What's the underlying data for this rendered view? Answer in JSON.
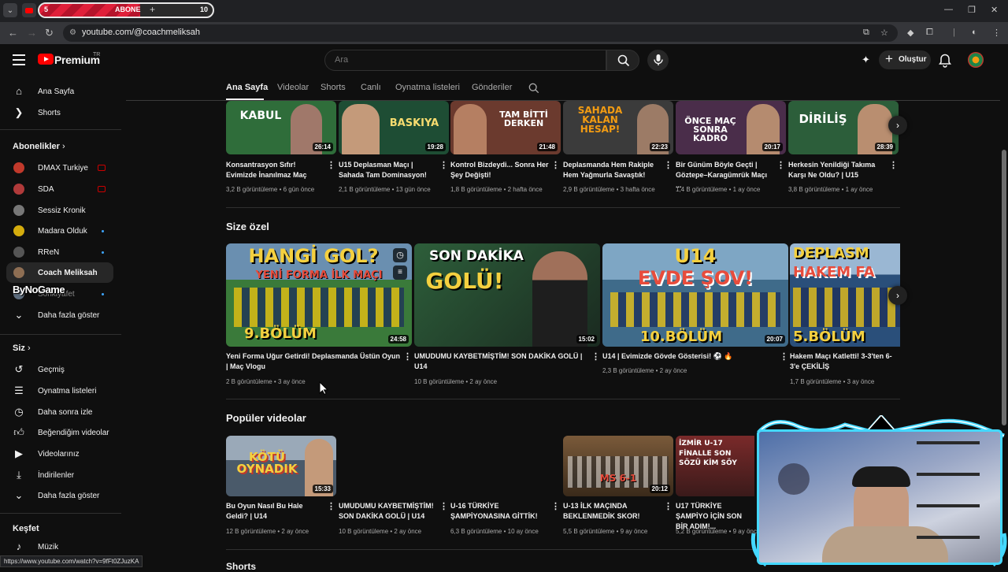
{
  "browser": {
    "subscriber_goal": {
      "start": "5",
      "label": "ABONE",
      "end": "10",
      "progress": 0.58
    },
    "url": "youtube.com/@coachmeliksah",
    "status_url": "https://www.youtube.com/watch?v=9fFt0ZJuzKA"
  },
  "header": {
    "logo_text": "Premium",
    "country_code": "TR",
    "search_placeholder": "Ara",
    "create_label": "Oluştur"
  },
  "sidebar": {
    "main": [
      {
        "label": "Ana Sayfa",
        "icon": "home-icon"
      },
      {
        "label": "Shorts",
        "icon": "shorts-icon"
      }
    ],
    "subscriptions_title": "Abonelikler",
    "subscriptions": [
      {
        "label": "DMAX Turkiye",
        "badge": "live"
      },
      {
        "label": "SDA",
        "badge": "live"
      },
      {
        "label": "Sessiz Kronik",
        "badge": ""
      },
      {
        "label": "Madara Olduk",
        "badge": "new"
      },
      {
        "label": "RReN",
        "badge": "new"
      },
      {
        "label": "Coach Meliksah",
        "badge": "",
        "active": true
      },
      {
        "label": "Sonkiyafet",
        "badge": "new"
      }
    ],
    "show_more": "Daha fazla göster",
    "you_title": "Siz",
    "you_items": [
      {
        "label": "Geçmiş",
        "icon": "history-icon"
      },
      {
        "label": "Oynatma listeleri",
        "icon": "playlists-icon"
      },
      {
        "label": "Daha sonra izle",
        "icon": "watch-later-icon"
      },
      {
        "label": "Beğendiğim videolar",
        "icon": "liked-icon"
      },
      {
        "label": "Videolarınız",
        "icon": "your-videos-icon"
      },
      {
        "label": "İndirilenler",
        "icon": "downloads-icon"
      }
    ],
    "you_show_more": "Daha fazla göster",
    "explore_title": "Keşfet",
    "explore_items": [
      {
        "label": "Müzik",
        "icon": "music-icon"
      }
    ],
    "watermark": "ByNoGame"
  },
  "channel_tabs": [
    "Ana Sayfa",
    "Videolar",
    "Shorts",
    "Canlı",
    "Oynatma listeleri",
    "Gönderiler"
  ],
  "rows": {
    "top": [
      {
        "thumb_text": "KABUL",
        "title": "Konsantrasyon Sıfır! Evimizde İnanılmaz Maç",
        "views": "3,2 B görüntüleme",
        "age": "6 gün önce",
        "duration": "26:14",
        "bg": "#2f6d3a"
      },
      {
        "thumb_text": "BASKIYA",
        "title": "U15 Deplasman Maçı | Sahada Tam Dominasyon!",
        "views": "2,1 B görüntüleme",
        "age": "13 gün önce",
        "duration": "19:28",
        "bg": "#1e4d34"
      },
      {
        "thumb_text": "TAM BİTTİ DERKEN",
        "title": "Kontrol Bizdeydi... Sonra Her Şey Değişti!",
        "views": "1,8 B görüntüleme",
        "age": "2 hafta önce",
        "duration": "21:48",
        "bg": "#6b3a2e"
      },
      {
        "thumb_text": "SAHADA KALAN HESAP!",
        "title": "Deplasmanda Hem Rakiple Hem Yağmurla Savaştık!",
        "views": "2,9 B görüntüleme",
        "age": "3 hafta önce",
        "duration": "22:23",
        "bg": "#3b3b3b"
      },
      {
        "thumb_text": "ÖNCE MAÇ SONRA KADRO",
        "title": "Bir Günüm Böyle Geçti | Göztepe–Karagümrük Maçı ...",
        "views": "1,4 B görüntüleme",
        "age": "1 ay önce",
        "duration": "20:17",
        "bg": "#4a2d4a"
      },
      {
        "thumb_text": "DİRİLİŞ",
        "title": "Herkesin Yenildiği Takıma Karşı Ne Oldu? | U15",
        "views": "3,8 B görüntüleme",
        "age": "1 ay önce",
        "duration": "28:39",
        "bg": "#2c5e3a"
      }
    ],
    "for_you_title": "Size özel",
    "for_you": [
      {
        "thumb_top": "HANGİ GOL?",
        "thumb_mid": "YENİ FORMA İLK MAÇI",
        "thumb_bot": "9.BÖLÜM",
        "title": "Yeni Forma Uğur Getirdi! Deplasmanda Üstün Oyun | Maç Vlogu",
        "views": "2 B görüntüleme",
        "age": "3 ay önce",
        "duration": "24:58",
        "bg": "#3a7a3a"
      },
      {
        "thumb_top": "SON DAKİKA",
        "thumb_mid": "GOLÜ!",
        "thumb_bot": "",
        "title": "UMUDUMU KAYBETMİŞTİM! SON DAKİKA GOLÜ | U14",
        "views": "10 B görüntüleme",
        "age": "2 ay önce",
        "duration": "15:02",
        "bg": "#1f3b2a"
      },
      {
        "thumb_top": "U14",
        "thumb_mid": "EVDE ŞOV!",
        "thumb_bot": "10.BÖLÜM",
        "title": "U14 | Evimizde Gövde Gösterisi! ⚽ 🔥",
        "views": "2,3 B görüntüleme",
        "age": "2 ay önce",
        "duration": "20:07",
        "bg": "#3f6b8a"
      },
      {
        "thumb_top": "DEPLASM",
        "thumb_mid": "HAKEM FA",
        "thumb_bot": "5.BÖLÜM",
        "title": "Hakem Maçı Katletti! 3-3'ten 6-3'e ÇEKİLİŞ",
        "views": "1,7 B görüntüleme",
        "age": "3 ay önce",
        "duration": "",
        "bg": "#2a4f7a"
      }
    ],
    "popular_title": "Popüler videolar",
    "popular": [
      {
        "thumb_text": "KÖTÜ OYNADIK",
        "title": "Bu Oyun Nasıl Bu Hale Geldi? | U14",
        "views": "12 B görüntüleme",
        "age": "2 ay önce",
        "duration": "15:33",
        "bg": "#4a5a6a"
      },
      {
        "thumb_text": "",
        "title": "UMUDUMU KAYBETMİŞTİM! SON DAKİKA GOLÜ | U14",
        "views": "10 B görüntüleme",
        "age": "2 ay önce",
        "duration": "",
        "bg": ""
      },
      {
        "thumb_text": "",
        "title": "U-16 TÜRKİYE ŞAMPİYONASINA GİTTİK!",
        "views": "6,3 B görüntüleme",
        "age": "10 ay önce",
        "duration": "",
        "bg": ""
      },
      {
        "thumb_text": "MS 6-1",
        "title": "U-13 İLK MAÇINDA BEKLENMEDİK SKOR!",
        "views": "5,5 B görüntüleme",
        "age": "9 ay önce",
        "duration": "20:12",
        "bg": "#5a3a2a"
      },
      {
        "thumb_text": "İZMİR U-17 FİNALLE SON SÖZÜ KİM SÖY",
        "title": "U17 TÜRKİYE ŞAMPİYO İÇİN SON BİR ADIM!...",
        "views": "5,2 B görüntüleme",
        "age": "9 ay önce",
        "duration": "",
        "bg": "#7a2a2a"
      }
    ],
    "shorts_title": "Shorts"
  }
}
